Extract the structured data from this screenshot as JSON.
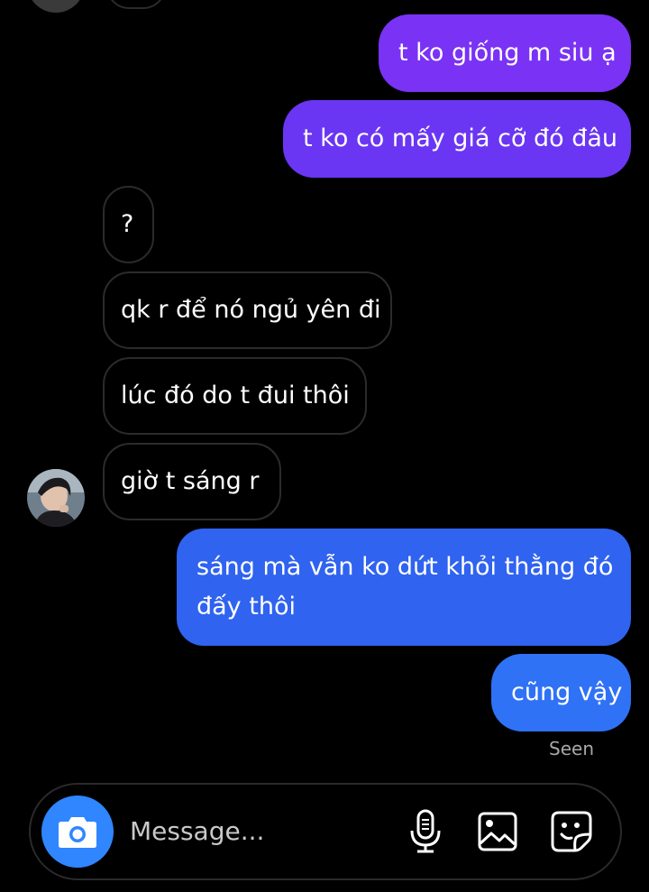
{
  "messages": [
    {
      "text": "t ko giống m siu ạ",
      "direction": "outgoing",
      "color": "#7a32f5"
    },
    {
      "text": "t ko có mấy giá cỡ đó đâu",
      "direction": "outgoing",
      "color": "#6a36f3"
    },
    {
      "text": "?",
      "direction": "incoming"
    },
    {
      "text": "qk r để nó ngủ yên đi",
      "direction": "incoming"
    },
    {
      "text": "lúc đó do t đui thôi",
      "direction": "incoming"
    },
    {
      "text": "giờ t sáng r",
      "direction": "incoming"
    },
    {
      "text_line1": "sáng mà vẫn ko dứt khỏi thằng đó",
      "text_line2": "đấy thôi",
      "direction": "outgoing",
      "color": "#2f63f0"
    },
    {
      "text": "cũng vậy",
      "direction": "outgoing",
      "color": "#2f72f5"
    }
  ],
  "status": {
    "seen": "Seen"
  },
  "composer": {
    "placeholder": "Message...",
    "icons": [
      "camera-icon",
      "microphone-icon",
      "gallery-icon",
      "sticker-icon"
    ],
    "accent": "#2f86ff"
  }
}
